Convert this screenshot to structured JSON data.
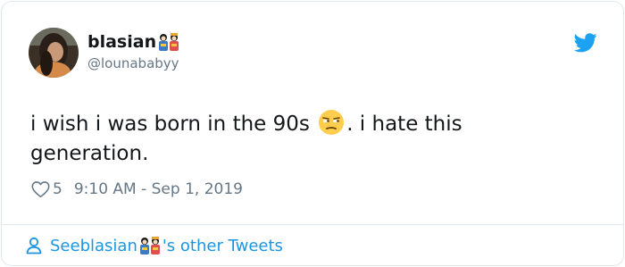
{
  "tweet": {
    "author": {
      "display_name": "blasian",
      "name_emoji": "dolls-emoji",
      "handle": "@lounababyy",
      "avatar": "user-avatar-photo"
    },
    "text_before_emoji": "i wish i was born in the 90s ",
    "inline_emoji": "unamused-face-emoji",
    "text_after_emoji": ". i hate this generation.",
    "likes": "5",
    "timestamp": "9:10 AM - Sep 1, 2019",
    "platform_icon": "twitter-bird-icon"
  },
  "footer": {
    "prefix": "See ",
    "name": "blasian",
    "suffix": "'s other Tweets",
    "icon": "person-icon"
  },
  "colors": {
    "link_blue": "#1b95e0",
    "twitter_blue": "#1da1f2",
    "muted_gray": "#657786",
    "border": "#e1e8ed",
    "text": "#14171a"
  }
}
